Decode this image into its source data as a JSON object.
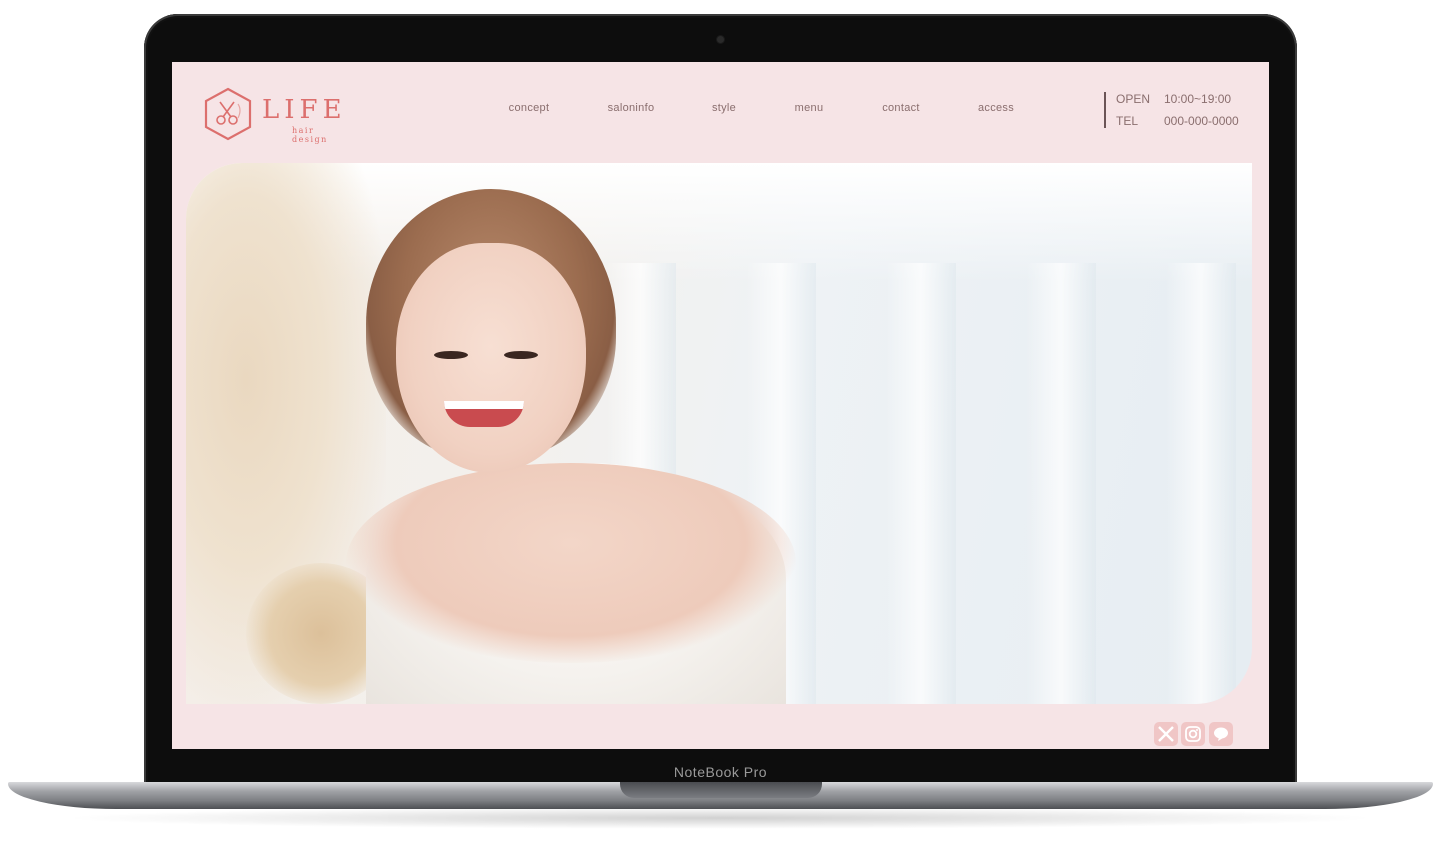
{
  "brand": {
    "name": "LIFE",
    "tagline": "hair design",
    "accent": "#dc6f6d"
  },
  "nav": {
    "items": [
      {
        "label": "concept"
      },
      {
        "label": "saloninfo"
      },
      {
        "label": "style"
      },
      {
        "label": "menu"
      },
      {
        "label": "contact"
      },
      {
        "label": "access"
      }
    ]
  },
  "info": {
    "open_label": "OPEN",
    "open_value": "10:00~19:00",
    "tel_label": "TEL",
    "tel_value": "000-000-0000"
  },
  "hero": {
    "image": "hero-photo-smiling-woman"
  },
  "social": [
    {
      "icon": "x-icon"
    },
    {
      "icon": "instagram-icon"
    },
    {
      "icon": "line-icon"
    }
  ],
  "device": {
    "model_label": "NoteBook Pro"
  },
  "colors": {
    "page_bg": "#f6e4e6",
    "nav_text": "#8a6e6e",
    "social_icon": "#f0c6c6"
  }
}
